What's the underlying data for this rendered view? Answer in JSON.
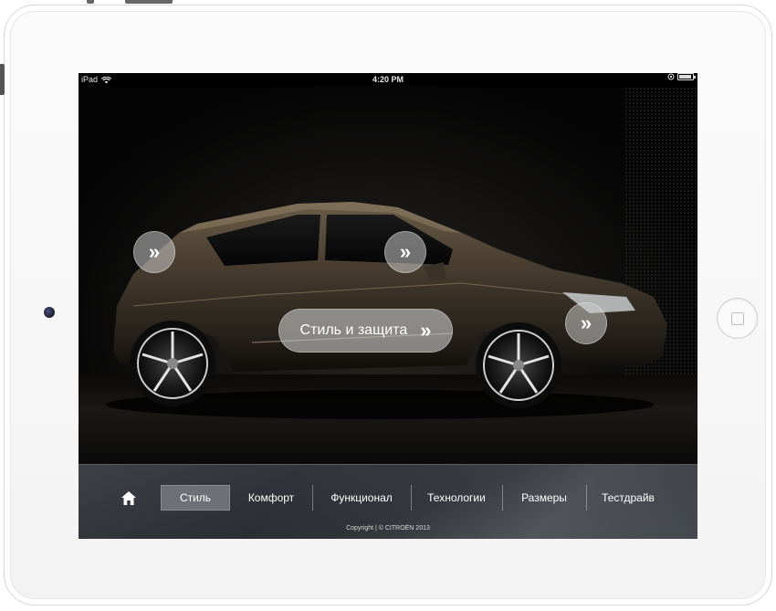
{
  "status_bar": {
    "device": "iPad",
    "time": "4:20 PM"
  },
  "hero": {
    "cta_label": "Стиль и защита",
    "hotspot_glyph": "»"
  },
  "nav": {
    "items": [
      {
        "label": "Стиль",
        "active": true
      },
      {
        "label": "Комфорт",
        "active": false
      },
      {
        "label": "Функционал",
        "active": false
      },
      {
        "label": "Технологии",
        "active": false
      },
      {
        "label": "Размеры",
        "active": false
      },
      {
        "label": "Тестдрайв",
        "active": false
      }
    ],
    "copyright": "Copyright | © CITROËN 2013"
  },
  "colors": {
    "screen_bg": "#000000",
    "nav_bg": "#2c3036",
    "active_tab": "#6d7075",
    "hotspot": "#c8c8c8",
    "car_body": "#4a3f31"
  },
  "icons": [
    "wifi-icon",
    "home-icon",
    "chevron-double-right-icon",
    "battery-icon",
    "lock-rotation-icon"
  ]
}
